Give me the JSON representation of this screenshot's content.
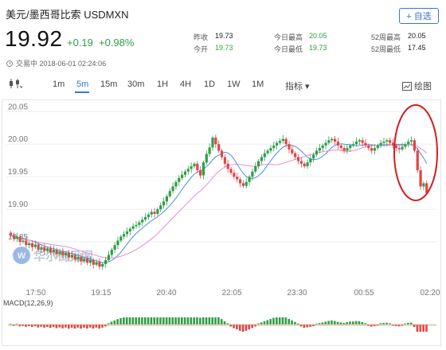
{
  "header": {
    "title": "美元/墨西哥比索  USDMXN",
    "add_label": "+ 自选",
    "price": "19.92",
    "change": "+0.19",
    "change_pct": "+0.98%",
    "status": "交易中 2018-06-01 02:24:06",
    "stats": [
      {
        "label": "昨收",
        "value": "19.73"
      },
      {
        "label": "今开",
        "value": "19.73"
      },
      {
        "label": "今日最高",
        "value": "20.05"
      },
      {
        "label": "今日最低",
        "value": "19.73"
      },
      {
        "label": "52周最高",
        "value": "20.05"
      },
      {
        "label": "52周最低",
        "value": "17.45"
      }
    ]
  },
  "toolbar": {
    "periods": [
      "1m",
      "5m",
      "15m",
      "30m",
      "1H",
      "4H",
      "1D",
      "1W",
      "1M"
    ],
    "active": "5m",
    "indicator_label": "指标",
    "draw_label": "绘图"
  },
  "chart_data": {
    "type": "candlestick",
    "y_ticks": [
      "20.05",
      "20.00",
      "19.95",
      "19.90",
      "19.85"
    ],
    "x_ticks": [
      "17:50",
      "19:15",
      "20:40",
      "22:05",
      "23:30",
      "00:55",
      "02:20"
    ],
    "ylim": [
      19.8,
      20.065
    ],
    "macd_label": "MACD(12,26,9)",
    "watermark": "华尔街见闻",
    "colors": {
      "up": "#2e9e48",
      "down": "#e04545",
      "ma1": "#4a90e2",
      "ma2": "#e98bd2",
      "highlight": "#d21e1e"
    },
    "close_series": [
      19.86,
      19.855,
      19.858,
      19.85,
      19.852,
      19.845,
      19.848,
      19.842,
      19.846,
      19.838,
      19.842,
      19.836,
      19.84,
      19.834,
      19.838,
      19.831,
      19.835,
      19.829,
      19.833,
      19.826,
      19.83,
      19.823,
      19.827,
      19.82,
      19.824,
      19.818,
      19.822,
      19.815,
      19.819,
      19.812,
      19.816,
      19.822,
      19.83,
      19.838,
      19.845,
      19.852,
      19.858,
      19.862,
      19.866,
      19.87,
      19.874,
      19.876,
      19.88,
      19.884,
      19.888,
      19.892,
      19.896,
      19.893,
      19.9,
      19.906,
      19.912,
      19.92,
      19.928,
      19.935,
      19.942,
      19.948,
      19.953,
      19.958,
      19.962,
      19.966,
      19.97,
      19.96,
      19.952,
      19.972,
      19.985,
      19.995,
      20.01,
      20.0,
      19.99,
      19.98,
      19.97,
      19.962,
      19.956,
      19.95,
      19.946,
      19.94,
      19.936,
      19.942,
      19.95,
      19.958,
      19.966,
      19.974,
      19.98,
      19.986,
      19.99,
      19.994,
      19.998,
      20.002,
      20.005,
      20.008,
      20.0,
      19.992,
      19.986,
      19.98,
      19.974,
      19.97,
      19.966,
      19.972,
      19.978,
      19.984,
      19.99,
      19.994,
      19.998,
      20.002,
      20.006,
      20.008,
      20.004,
      19.998,
      19.994,
      19.99,
      19.994,
      19.998,
      20.0,
      20.004,
      20.006,
      20.002,
      19.998,
      19.994,
      19.99,
      19.994,
      19.998,
      20.002,
      20.004,
      20.006,
      20.002,
      19.998,
      19.994,
      19.992,
      19.996,
      20.0,
      20.004,
      20.006,
      19.99,
      19.96,
      19.935,
      19.94,
      19.925
    ]
  }
}
